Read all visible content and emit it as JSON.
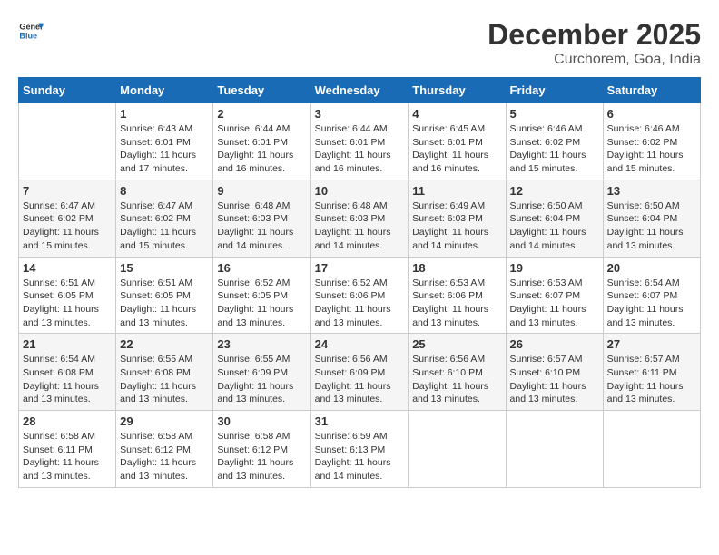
{
  "header": {
    "logo_line1": "General",
    "logo_line2": "Blue",
    "month_year": "December 2025",
    "location": "Curchorem, Goa, India"
  },
  "weekdays": [
    "Sunday",
    "Monday",
    "Tuesday",
    "Wednesday",
    "Thursday",
    "Friday",
    "Saturday"
  ],
  "weeks": [
    [
      {
        "day": null,
        "info": null
      },
      {
        "day": "1",
        "info": "Sunrise: 6:43 AM\nSunset: 6:01 PM\nDaylight: 11 hours\nand 17 minutes."
      },
      {
        "day": "2",
        "info": "Sunrise: 6:44 AM\nSunset: 6:01 PM\nDaylight: 11 hours\nand 16 minutes."
      },
      {
        "day": "3",
        "info": "Sunrise: 6:44 AM\nSunset: 6:01 PM\nDaylight: 11 hours\nand 16 minutes."
      },
      {
        "day": "4",
        "info": "Sunrise: 6:45 AM\nSunset: 6:01 PM\nDaylight: 11 hours\nand 16 minutes."
      },
      {
        "day": "5",
        "info": "Sunrise: 6:46 AM\nSunset: 6:02 PM\nDaylight: 11 hours\nand 15 minutes."
      },
      {
        "day": "6",
        "info": "Sunrise: 6:46 AM\nSunset: 6:02 PM\nDaylight: 11 hours\nand 15 minutes."
      }
    ],
    [
      {
        "day": "7",
        "info": "Sunrise: 6:47 AM\nSunset: 6:02 PM\nDaylight: 11 hours\nand 15 minutes."
      },
      {
        "day": "8",
        "info": "Sunrise: 6:47 AM\nSunset: 6:02 PM\nDaylight: 11 hours\nand 15 minutes."
      },
      {
        "day": "9",
        "info": "Sunrise: 6:48 AM\nSunset: 6:03 PM\nDaylight: 11 hours\nand 14 minutes."
      },
      {
        "day": "10",
        "info": "Sunrise: 6:48 AM\nSunset: 6:03 PM\nDaylight: 11 hours\nand 14 minutes."
      },
      {
        "day": "11",
        "info": "Sunrise: 6:49 AM\nSunset: 6:03 PM\nDaylight: 11 hours\nand 14 minutes."
      },
      {
        "day": "12",
        "info": "Sunrise: 6:50 AM\nSunset: 6:04 PM\nDaylight: 11 hours\nand 14 minutes."
      },
      {
        "day": "13",
        "info": "Sunrise: 6:50 AM\nSunset: 6:04 PM\nDaylight: 11 hours\nand 13 minutes."
      }
    ],
    [
      {
        "day": "14",
        "info": "Sunrise: 6:51 AM\nSunset: 6:05 PM\nDaylight: 11 hours\nand 13 minutes."
      },
      {
        "day": "15",
        "info": "Sunrise: 6:51 AM\nSunset: 6:05 PM\nDaylight: 11 hours\nand 13 minutes."
      },
      {
        "day": "16",
        "info": "Sunrise: 6:52 AM\nSunset: 6:05 PM\nDaylight: 11 hours\nand 13 minutes."
      },
      {
        "day": "17",
        "info": "Sunrise: 6:52 AM\nSunset: 6:06 PM\nDaylight: 11 hours\nand 13 minutes."
      },
      {
        "day": "18",
        "info": "Sunrise: 6:53 AM\nSunset: 6:06 PM\nDaylight: 11 hours\nand 13 minutes."
      },
      {
        "day": "19",
        "info": "Sunrise: 6:53 AM\nSunset: 6:07 PM\nDaylight: 11 hours\nand 13 minutes."
      },
      {
        "day": "20",
        "info": "Sunrise: 6:54 AM\nSunset: 6:07 PM\nDaylight: 11 hours\nand 13 minutes."
      }
    ],
    [
      {
        "day": "21",
        "info": "Sunrise: 6:54 AM\nSunset: 6:08 PM\nDaylight: 11 hours\nand 13 minutes."
      },
      {
        "day": "22",
        "info": "Sunrise: 6:55 AM\nSunset: 6:08 PM\nDaylight: 11 hours\nand 13 minutes."
      },
      {
        "day": "23",
        "info": "Sunrise: 6:55 AM\nSunset: 6:09 PM\nDaylight: 11 hours\nand 13 minutes."
      },
      {
        "day": "24",
        "info": "Sunrise: 6:56 AM\nSunset: 6:09 PM\nDaylight: 11 hours\nand 13 minutes."
      },
      {
        "day": "25",
        "info": "Sunrise: 6:56 AM\nSunset: 6:10 PM\nDaylight: 11 hours\nand 13 minutes."
      },
      {
        "day": "26",
        "info": "Sunrise: 6:57 AM\nSunset: 6:10 PM\nDaylight: 11 hours\nand 13 minutes."
      },
      {
        "day": "27",
        "info": "Sunrise: 6:57 AM\nSunset: 6:11 PM\nDaylight: 11 hours\nand 13 minutes."
      }
    ],
    [
      {
        "day": "28",
        "info": "Sunrise: 6:58 AM\nSunset: 6:11 PM\nDaylight: 11 hours\nand 13 minutes."
      },
      {
        "day": "29",
        "info": "Sunrise: 6:58 AM\nSunset: 6:12 PM\nDaylight: 11 hours\nand 13 minutes."
      },
      {
        "day": "30",
        "info": "Sunrise: 6:58 AM\nSunset: 6:12 PM\nDaylight: 11 hours\nand 13 minutes."
      },
      {
        "day": "31",
        "info": "Sunrise: 6:59 AM\nSunset: 6:13 PM\nDaylight: 11 hours\nand 14 minutes."
      },
      {
        "day": null,
        "info": null
      },
      {
        "day": null,
        "info": null
      },
      {
        "day": null,
        "info": null
      }
    ]
  ]
}
